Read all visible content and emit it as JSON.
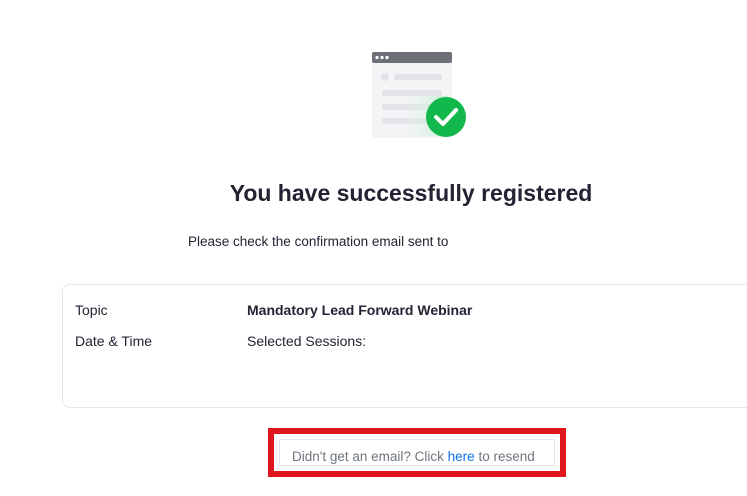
{
  "heading": "You have successfully registered",
  "subtitle": "Please check the confirmation email sent to",
  "details": {
    "topic_label": "Topic",
    "topic_value": "Mandatory Lead Forward Webinar",
    "datetime_label": "Date & Time",
    "datetime_value": "Selected Sessions:"
  },
  "resend": {
    "prefix": "Didn't get an email? Click ",
    "link_text": "here",
    "suffix": " to resend"
  },
  "colors": {
    "success_green": "#12b84c",
    "link_blue": "#0e72ed",
    "highlight_red": "#e0161c"
  },
  "icons": {
    "illustration": "email-document-check-icon"
  }
}
